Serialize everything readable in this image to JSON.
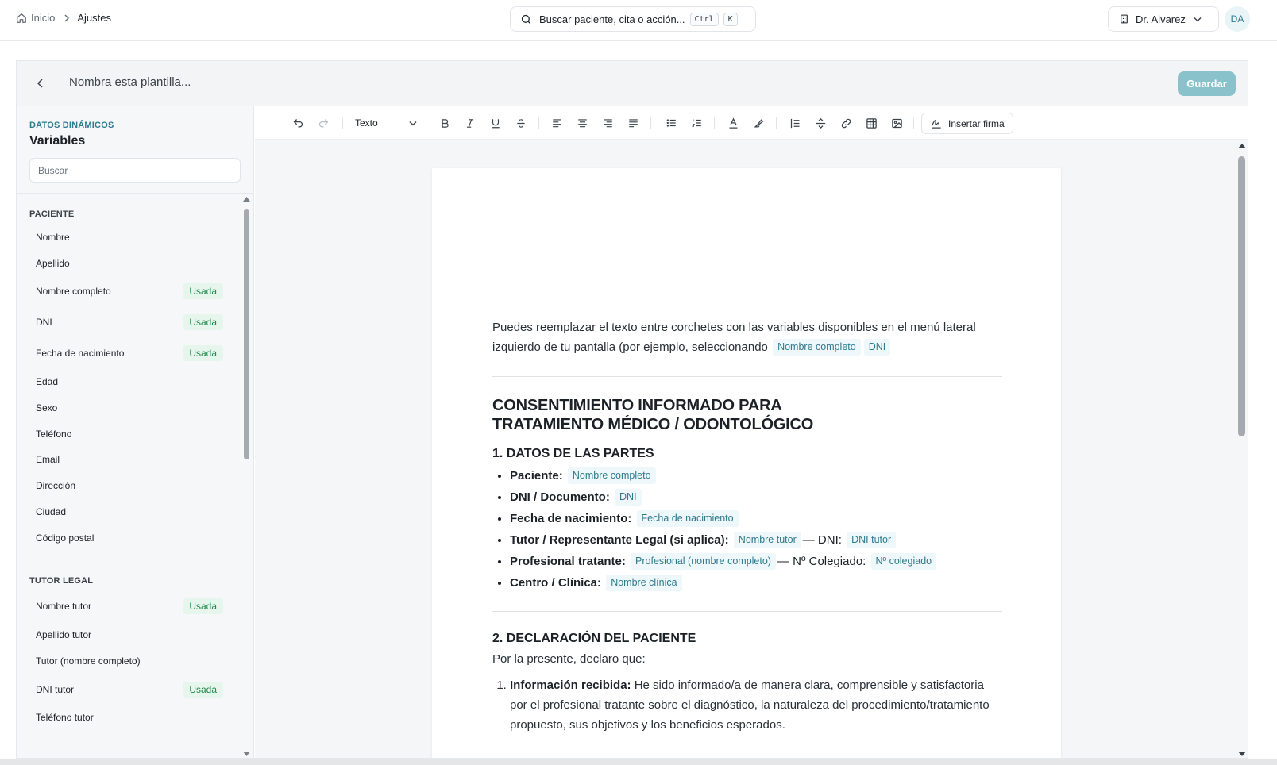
{
  "topbar": {
    "breadcrumb": {
      "home": "Inicio",
      "current": "Ajustes"
    },
    "search": {
      "placeholder": "Buscar paciente, cita o acción...",
      "shortcut_keys": [
        "Ctrl",
        "K"
      ]
    },
    "user": {
      "name": "Dr. Alvarez",
      "initials": "DA"
    }
  },
  "editor_header": {
    "title_placeholder": "Nombra esta plantilla...",
    "save_label": "Guardar"
  },
  "sidebar": {
    "kicker": "DATOS DINÁMICOS",
    "title": "Variables",
    "search_placeholder": "Buscar",
    "used_label": "Usada",
    "sections": [
      {
        "title": "PACIENTE",
        "items": [
          {
            "label": "Nombre",
            "used": false
          },
          {
            "label": "Apellido",
            "used": false
          },
          {
            "label": "Nombre completo",
            "used": true
          },
          {
            "label": "DNI",
            "used": true
          },
          {
            "label": "Fecha de nacimiento",
            "used": true
          },
          {
            "label": "Edad",
            "used": false
          },
          {
            "label": "Sexo",
            "used": false
          },
          {
            "label": "Teléfono",
            "used": false
          },
          {
            "label": "Email",
            "used": false
          },
          {
            "label": "Dirección",
            "used": false
          },
          {
            "label": "Ciudad",
            "used": false
          },
          {
            "label": "Código postal",
            "used": false
          }
        ]
      },
      {
        "title": "TUTOR LEGAL",
        "items": [
          {
            "label": "Nombre tutor",
            "used": true
          },
          {
            "label": "Apellido tutor",
            "used": false
          },
          {
            "label": "Tutor (nombre completo)",
            "used": false
          },
          {
            "label": "DNI tutor",
            "used": true
          },
          {
            "label": "Teléfono tutor",
            "used": false
          }
        ]
      }
    ]
  },
  "toolbar": {
    "text_style": "Texto",
    "insert_signature": "Insertar firma"
  },
  "document": {
    "intro": "Puedes reemplazar el texto entre corchetes con las variables disponibles en el menú lateral izquierdo de tu pantalla (por ejemplo, seleccionando",
    "intro_chips": [
      "Nombre completo",
      "DNI"
    ],
    "title_line1": "CONSENTIMIENTO INFORMADO PARA",
    "title_line2": "TRATAMIENTO MÉDICO / ODONTOLÓGICO",
    "section1_title": "1. DATOS DE LAS PARTES",
    "parties": [
      {
        "label": "Paciente:",
        "chip": "Nombre completo"
      },
      {
        "label": "DNI / Documento:",
        "chip": "DNI"
      },
      {
        "label": "Fecha de nacimiento:",
        "chip": "Fecha de nacimiento"
      },
      {
        "label": "Tutor / Representante Legal (si aplica):",
        "chip": "Nombre tutor",
        "mid": "— DNI:",
        "chip2": "DNI tutor"
      },
      {
        "label": "Profesional tratante:",
        "chip": "Profesional (nombre completo)",
        "mid": "— Nº Colegiado:",
        "chip2": "Nº colegiado"
      },
      {
        "label": "Centro / Clínica:",
        "chip": "Nombre clínica"
      }
    ],
    "section2_title": "2. DECLARACIÓN DEL PACIENTE",
    "section2_intro": "Por la presente, declaro que:",
    "declarations": [
      {
        "label": "Información recibida:",
        "text": "He sido informado/a de manera clara, comprensible y satisfactoria por el profesional tratante sobre el diagnóstico, la naturaleza del procedimiento/tratamiento propuesto, sus objetivos y los beneficios esperados."
      }
    ]
  }
}
